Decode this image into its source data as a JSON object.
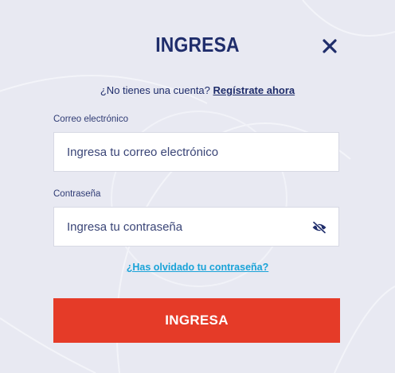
{
  "modal": {
    "title": "INGRESA",
    "close_icon": "close-icon"
  },
  "signup": {
    "prompt": "¿No tienes una cuenta?",
    "link_label": "Regístrate ahora"
  },
  "email_field": {
    "label": "Correo electrónico",
    "placeholder": "Ingresa tu correo electrónico",
    "value": ""
  },
  "password_field": {
    "label": "Contraseña",
    "placeholder": "Ingresa tu contraseña",
    "value": "",
    "toggle_icon": "eye-off-icon"
  },
  "forgot_password": {
    "label": "¿Has olvidado tu contraseña?"
  },
  "submit": {
    "label": "INGRESA"
  },
  "colors": {
    "background": "#e8e9f2",
    "primary_text": "#1f2d6b",
    "link_accent": "#1aa3d8",
    "submit_button": "#e53b28"
  }
}
